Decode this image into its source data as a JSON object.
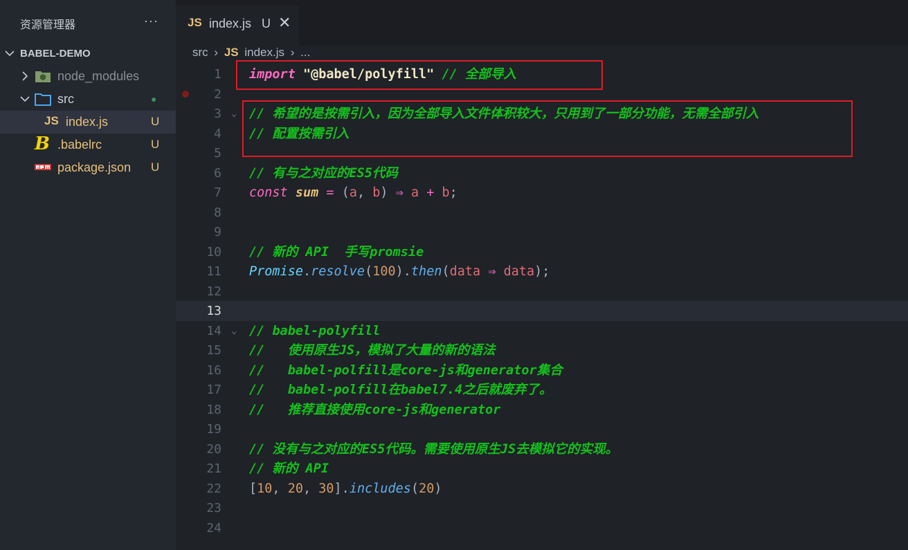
{
  "explorer": {
    "title": "资源管理器",
    "more": "···",
    "project": "BABEL-DEMO",
    "items": [
      {
        "label": "node_modules",
        "status": ""
      },
      {
        "label": "src",
        "status": "●"
      },
      {
        "label": "index.js",
        "status": "U"
      },
      {
        "label": ".babelrc",
        "status": "U"
      },
      {
        "label": "package.json",
        "status": "U"
      }
    ]
  },
  "tab": {
    "icon": "JS",
    "name": "index.js",
    "status": "U",
    "close": "✕"
  },
  "breadcrumb": {
    "folder": "src",
    "sep": "›",
    "icon": "JS",
    "file": "index.js",
    "more": "..."
  },
  "lines": [
    "1",
    "2",
    "3",
    "4",
    "5",
    "6",
    "7",
    "8",
    "9",
    "10",
    "11",
    "12",
    "13",
    "14",
    "15",
    "16",
    "17",
    "18",
    "19",
    "20",
    "21",
    "22",
    "23",
    "24"
  ],
  "code": {
    "l1_kw": "import",
    "l1_str": "\"@babel/polyfill\"",
    "l1_cm": "// 全部导入",
    "l3": "// 希望的是按需引入，因为全部导入文件体积较大，只用到了一部分功能，无需全部引入",
    "l4": "// 配置按需引入",
    "l6": "// 有与之对应的ES5代码",
    "l7_const": "const",
    "l7_sum": "sum",
    "l7_eq": "=",
    "l7_a": "a",
    "l7_b": "b",
    "l7_arrow": "⇒",
    "l7_plus": "+",
    "l10": "// 新的 API  手写promsie",
    "l11_promise": "Promise",
    "l11_resolve": "resolve",
    "l11_num": "100",
    "l11_then": "then",
    "l11_data": "data",
    "l11_arrow": "⇒",
    "l14": "// babel-polyfill",
    "l15": "//   使用原生JS，模拟了大量的新的语法",
    "l16": "//   babel-polfill是core-js和generator集合",
    "l17": "//   babel-polfill在babel7.4之后就废弃了。",
    "l18": "//   推荐直接使用core-js和generator",
    "l20": "// 没有与之对应的ES5代码。需要使用原生JS去模拟它的实现。",
    "l21": "// 新的 API",
    "l22_n1": "10",
    "l22_n2": "20",
    "l22_n3": "30",
    "l22_fn": "includes",
    "l22_arg": "20"
  },
  "colors": {
    "annotation_box": "#e01b24",
    "comment": "#14c11c",
    "keyword": "#ff6ac1"
  }
}
